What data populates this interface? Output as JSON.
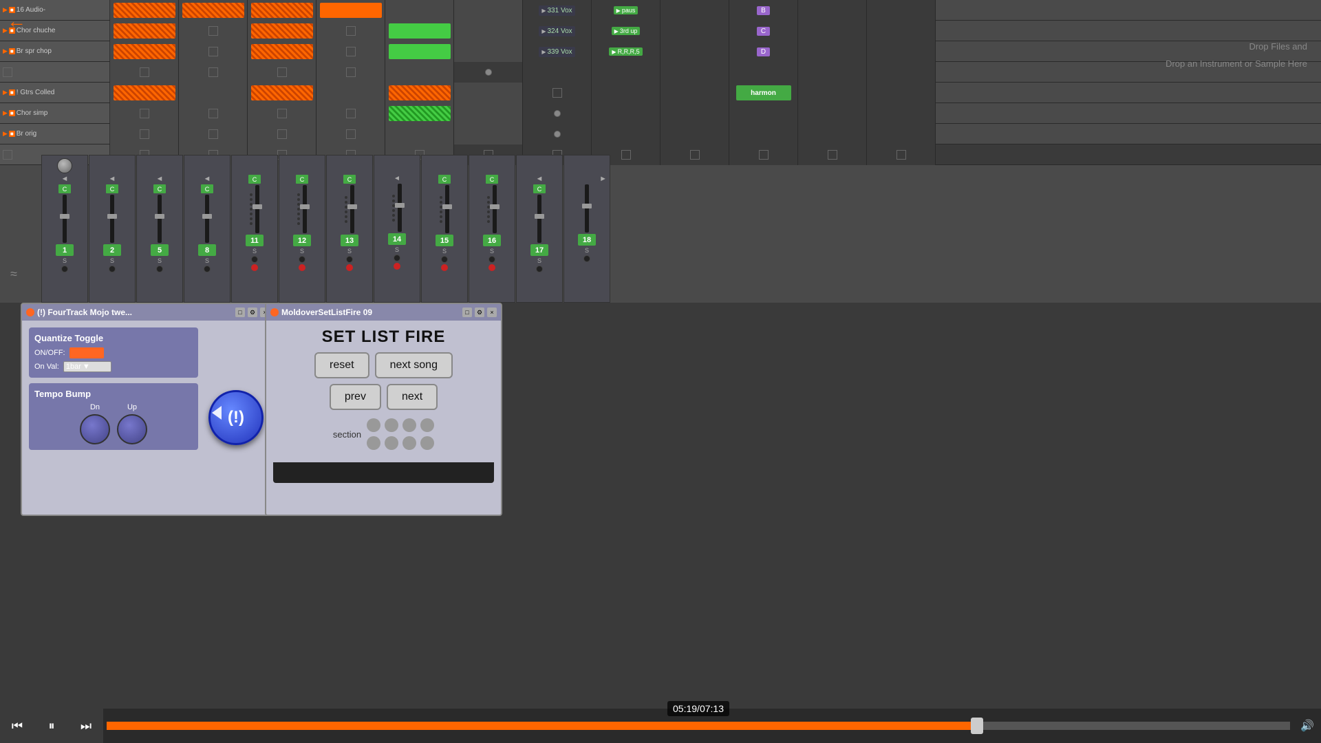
{
  "back_arrow": "←",
  "drop_files": "Drop Files and",
  "drop_instrument": "Drop an Instrument or Sample Here",
  "tracks": [
    {
      "name": "16 Audio-",
      "has_play": true,
      "color": "orange",
      "cells": [
        "striped-orange",
        "striped-orange",
        "striped-orange",
        "solid-orange",
        "empty",
        "empty",
        "vox-331",
        "btn-pause",
        "empty",
        "btn-B",
        "empty",
        "empty"
      ]
    },
    {
      "name": "Chor chuche",
      "has_play": true,
      "color": "orange",
      "cells": [
        "striped-orange",
        "empty",
        "striped-orange",
        "empty",
        "solid-green",
        "empty",
        "vox-324",
        "btn-3rd-up",
        "empty",
        "btn-C",
        "empty",
        "empty"
      ]
    },
    {
      "name": "Br spr chop",
      "has_play": true,
      "color": "orange",
      "cells": [
        "striped-orange",
        "empty",
        "striped-orange",
        "empty",
        "solid-green",
        "empty",
        "vox-339",
        "btn-RRR5",
        "empty",
        "btn-D",
        "empty",
        "empty"
      ]
    },
    {
      "name": "",
      "has_play": false,
      "cells": [
        "sq",
        "sq",
        "sq",
        "sq",
        "empty",
        "circle",
        "empty",
        "empty",
        "empty",
        "empty",
        "empty",
        "empty"
      ]
    },
    {
      "name": "! Gtrs Colled",
      "has_play": true,
      "color": "orange",
      "cells": [
        "striped-orange",
        "empty",
        "striped-orange",
        "empty",
        "striped-orange",
        "empty",
        "sq",
        "empty",
        "empty",
        "harmon",
        "empty",
        "empty"
      ]
    },
    {
      "name": "Chor simp",
      "has_play": true,
      "color": "orange",
      "cells": [
        "sq",
        "empty",
        "sq",
        "empty",
        "striped-green",
        "empty",
        "circle",
        "empty",
        "empty",
        "empty",
        "empty",
        "empty"
      ]
    },
    {
      "name": "Br orig",
      "has_play": true,
      "color": "orange",
      "cells": [
        "sq",
        "empty",
        "sq",
        "empty",
        "empty",
        "empty",
        "circle",
        "empty",
        "empty",
        "empty",
        "empty",
        "empty"
      ]
    }
  ],
  "mixer_channels": [
    {
      "num": "1",
      "has_knob": true
    },
    {
      "num": "2"
    },
    {
      "num": "5"
    },
    {
      "num": "8"
    },
    {
      "num": "11",
      "has_rec": true
    },
    {
      "num": "12",
      "has_rec": true
    },
    {
      "num": "13",
      "has_rec": true
    },
    {
      "num": "14",
      "has_rec": true
    },
    {
      "num": "15",
      "has_rec": true
    },
    {
      "num": "16",
      "has_rec": true
    },
    {
      "num": "17"
    },
    {
      "num": "18"
    }
  ],
  "fourtrack": {
    "title": "(!) FourTrack Mojo twe...",
    "quantize_toggle": "Quantize Toggle",
    "on_off_label": "ON/OFF:",
    "on_val_label": "On\nVal:",
    "on_val_value": "1bar",
    "big_btn_label": "(!)",
    "tempo_bump": "Tempo Bump",
    "dn_label": "Dn",
    "up_label": "Up"
  },
  "moldover": {
    "title": "MoldoverSetListFire 09",
    "set_list_title": "SET LIST FIRE",
    "reset_btn": "reset",
    "next_song_btn": "next song",
    "prev_btn": "prev",
    "next_btn": "next",
    "section_label": "section"
  },
  "transport": {
    "time_current": "05:19",
    "time_total": "07:13",
    "time_display": "05:19/07:13",
    "progress_pct": 73
  },
  "vox_labels": {
    "v331": "331 Vox",
    "v324": "324 Vox",
    "v339": "339 Vox"
  },
  "action_labels": {
    "pause": "paus",
    "third_up": "3rd up",
    "rrr5": "R,R,R,5",
    "B": "B",
    "C": "C",
    "D": "D",
    "harmon": "harmon"
  }
}
